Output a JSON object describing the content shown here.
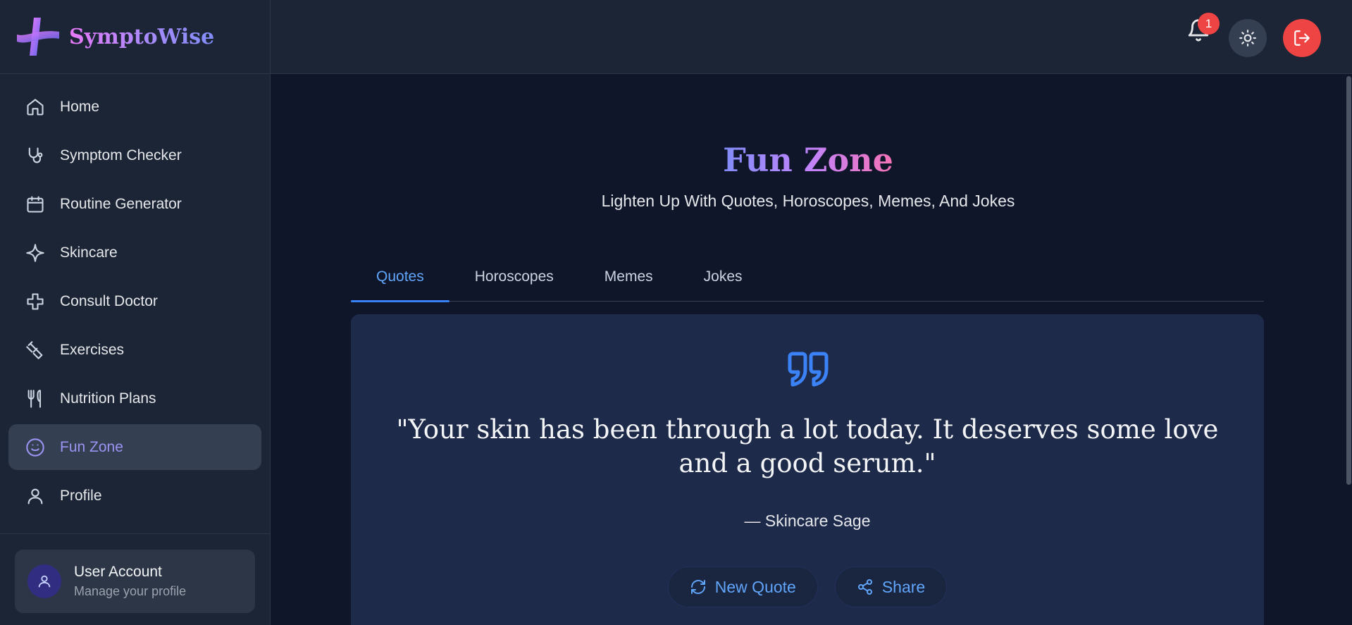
{
  "brand": {
    "name": "SymptoWise"
  },
  "sidebar": {
    "items": [
      {
        "label": "Home",
        "icon": "home-icon"
      },
      {
        "label": "Symptom Checker",
        "icon": "stethoscope-icon"
      },
      {
        "label": "Routine Generator",
        "icon": "calendar-icon"
      },
      {
        "label": "Skincare",
        "icon": "sparkle-icon"
      },
      {
        "label": "Consult Doctor",
        "icon": "medical-cross-icon"
      },
      {
        "label": "Exercises",
        "icon": "dumbbell-icon"
      },
      {
        "label": "Nutrition Plans",
        "icon": "utensils-icon"
      },
      {
        "label": "Fun Zone",
        "icon": "smile-icon",
        "active": true
      },
      {
        "label": "Profile",
        "icon": "user-icon"
      }
    ],
    "user": {
      "name": "User Account",
      "subtitle": "Manage your profile"
    }
  },
  "header": {
    "notification_count": "1"
  },
  "main": {
    "title": "Fun Zone",
    "subtitle": "Lighten Up With Quotes, Horoscopes, Memes, And Jokes",
    "tabs": [
      {
        "label": "Quotes",
        "active": true
      },
      {
        "label": "Horoscopes"
      },
      {
        "label": "Memes"
      },
      {
        "label": "Jokes"
      }
    ],
    "quote": {
      "text": "\"Your skin has been through a lot today. It deserves some love and a good serum.\"",
      "author": "— Skincare Sage"
    },
    "buttons": {
      "new_quote": "New Quote",
      "share": "Share"
    }
  },
  "colors": {
    "accent": "#60a5fa",
    "active_nav": "#9b93f2",
    "danger": "#ef4444"
  }
}
